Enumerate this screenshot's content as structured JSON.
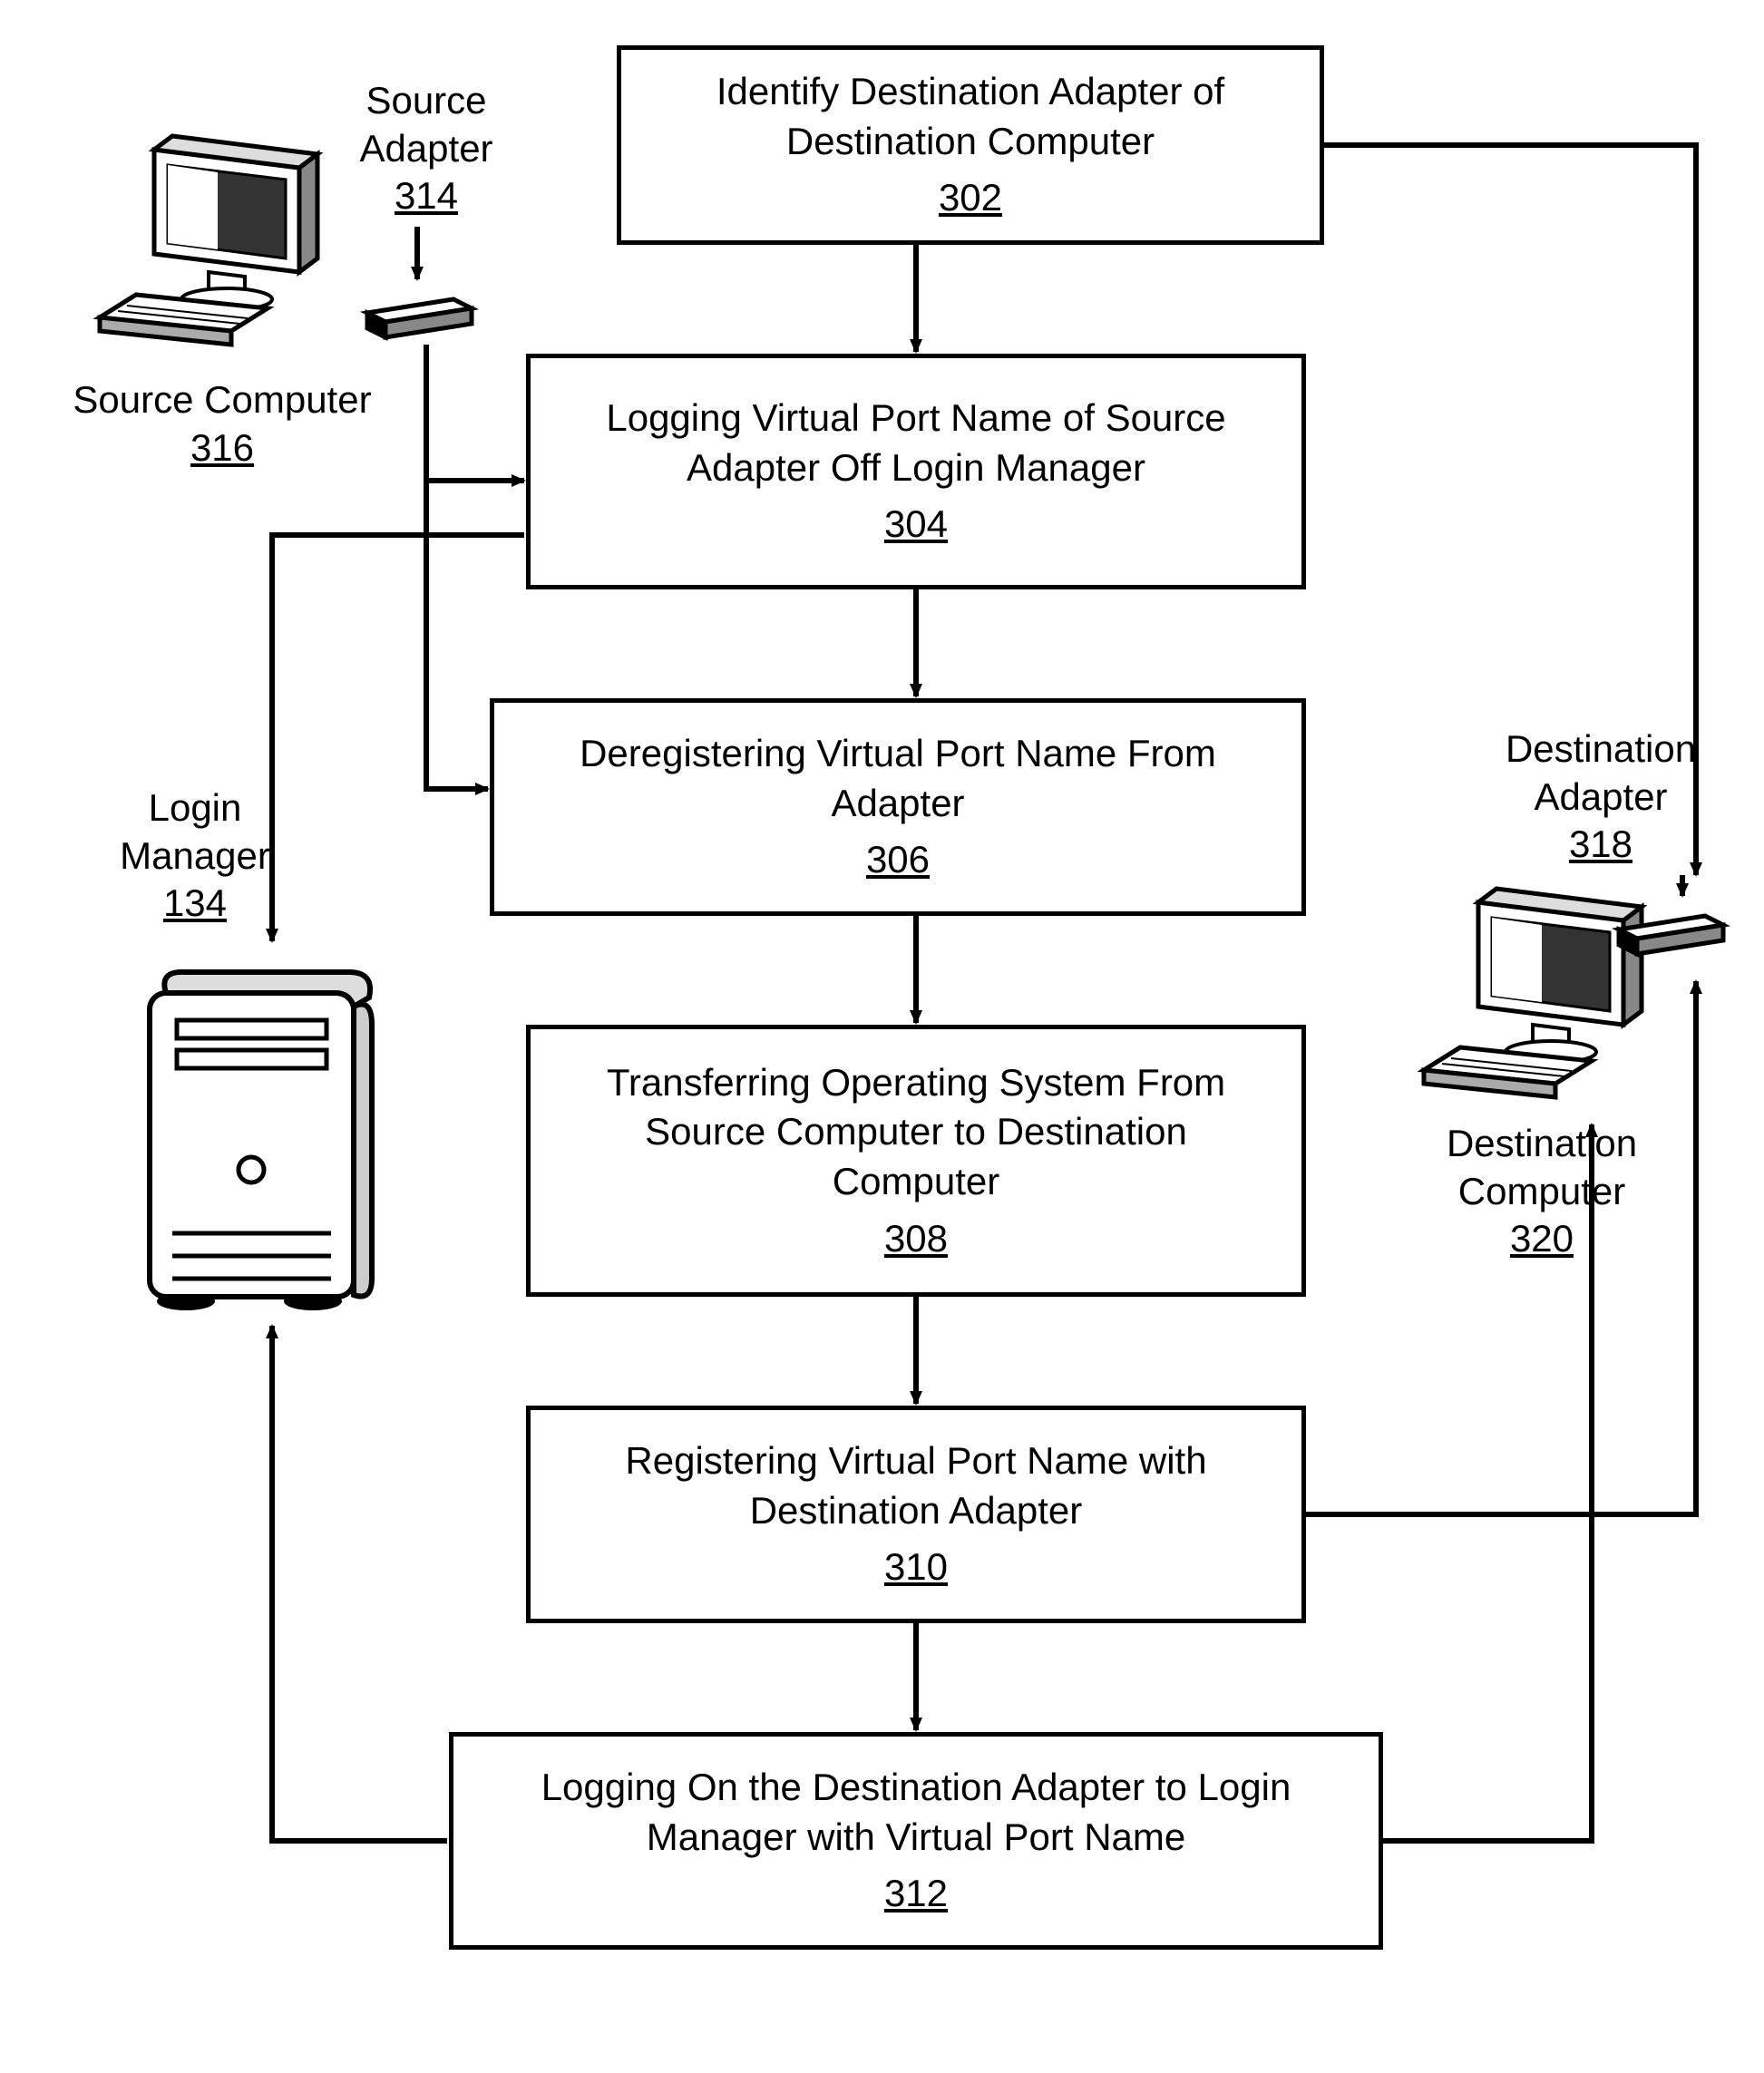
{
  "boxes": {
    "b302": {
      "text": "Identify Destination Adapter of Destination Computer",
      "ref": "302"
    },
    "b304": {
      "text": "Logging Virtual Port Name of Source Adapter Off Login Manager",
      "ref": "304"
    },
    "b306": {
      "text": "Deregistering Virtual Port Name From Adapter",
      "ref": "306"
    },
    "b308": {
      "text": "Transferring Operating System From Source Computer to Destination Computer",
      "ref": "308"
    },
    "b310": {
      "text": "Registering Virtual Port Name with Destination Adapter",
      "ref": "310"
    },
    "b312": {
      "text": "Logging On the Destination Adapter to Login Manager with Virtual Port Name",
      "ref": "312"
    }
  },
  "labels": {
    "sourceAdapter": {
      "text": "Source Adapter",
      "ref": "314"
    },
    "sourceComputer": {
      "text": "Source Computer",
      "ref": "316"
    },
    "loginManager": {
      "text": "Login Manager",
      "ref": "134"
    },
    "destAdapter": {
      "text": "Destination Adapter",
      "ref": "318"
    },
    "destComputer": {
      "text": "Destination Computer",
      "ref": "320"
    }
  }
}
